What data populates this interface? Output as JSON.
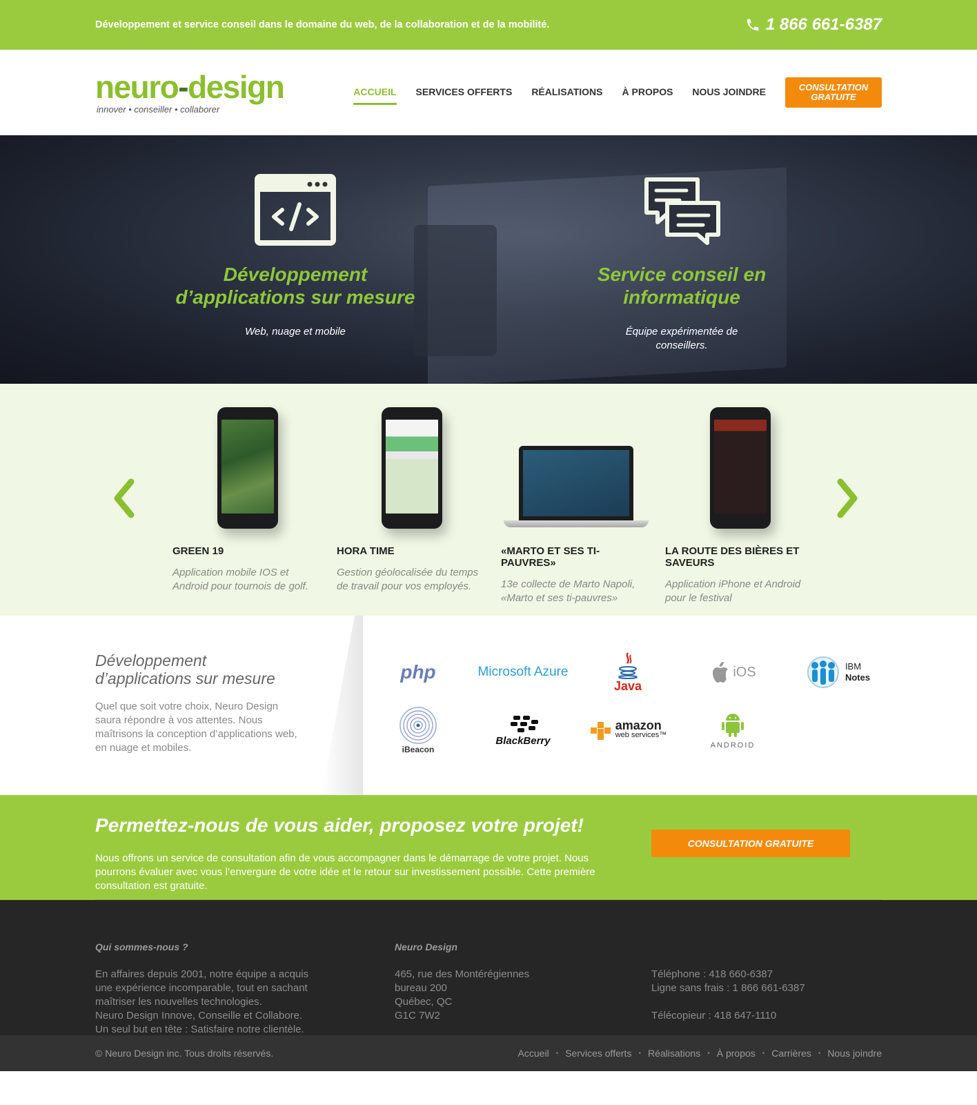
{
  "topbar": {
    "tagline": "Développement et service conseil dans le domaine du web, de la collaboration et de la mobilité.",
    "phone": "1 866 661-6387",
    "phone_icon": "phone-icon",
    "bg_color": "#9acb3e"
  },
  "header": {
    "logo_part1": "neuro",
    "logo_part2": "design",
    "logo_sub": "innover • conseiller • collaborer",
    "nav": [
      {
        "label": "ACCUEIL",
        "active": true
      },
      {
        "label": "SERVICES OFFERTS"
      },
      {
        "label": "RÉALISATIONS"
      },
      {
        "label": "À PROPOS"
      },
      {
        "label": "NOUS JOINDRE"
      }
    ],
    "cta": "CONSULTATION GRATUITE",
    "accent_color": "#8bbf2f",
    "cta_color": "#f48a0c"
  },
  "hero": {
    "items": [
      {
        "icon": "code-window-icon",
        "title_line1": "Développement",
        "title_line2": "d’applications sur mesure",
        "subtitle": "Web, nuage et mobile"
      },
      {
        "icon": "chat-bubbles-icon",
        "title_line1": "Service conseil en",
        "title_line2": "informatique",
        "subtitle": "Équipe expérimentée de conseillers."
      }
    ]
  },
  "projects": {
    "items": [
      {
        "title": "GREEN 19",
        "desc": "Application mobile IOS et Android pour tournois de golf."
      },
      {
        "title": "HORA TIME",
        "desc": "Gestion géolocalisée du temps de travail pour vos employés."
      },
      {
        "title": "«MARTO ET SES TI-PAUVRES»",
        "desc": "13e collecte de Marto Napoli, «Marto et ses ti-pauvres»"
      },
      {
        "title": "LA ROUTE DES BIÈRES ET SAVEURS",
        "desc": "Application iPhone et Android pour le festival"
      }
    ],
    "prev_icon": "chevron-left-icon",
    "next_icon": "chevron-right-icon"
  },
  "tech": {
    "heading": "Développement d’applications sur mesure",
    "text": "Quel que soit votre choix, Neuro Design saura répondre à vos attentes. Nous maîtrisons la conception d’applications web, en nuage et mobiles.",
    "logos": {
      "php": "php",
      "azure": "Microsoft Azure",
      "java": "Java",
      "ios": "iOS",
      "ibm_line1": "IBM",
      "ibm_line2": "Notes",
      "ibeacon": "iBeacon",
      "blackberry": "BlackBerry",
      "amazon": "amazon",
      "amazon_sub": "web services™",
      "android": "ANDROID"
    }
  },
  "band": {
    "heading": "Permettez-nous de vous aider, proposez votre projet!",
    "text": "Nous offrons un service de consultation afin de vous accompagner dans le démarrage de votre projet. Nous pourrons évaluer avec vous l’envergure de votre idée et le retour sur investissement possible. Cette première consultation est gratuite.",
    "button": "CONSULTATION GRATUITE"
  },
  "footer": {
    "about_title": "Qui sommes-nous ?",
    "about_lines": [
      "En affaires depuis 2001, notre équipe a acquis",
      "une expérience incomparable, tout en sachant",
      "maîtriser les nouvelles technologies.",
      "Neuro Design Innove, Conseille et Collabore.",
      "Un seul but en tête : Satisfaire notre clientèle."
    ],
    "company_title": "Neuro Design",
    "address_lines": [
      "465, rue des Montérégiennes",
      "bureau 200",
      "Québec, QC",
      "G1C 7W2"
    ],
    "phone": "Téléphone : 418 660-6387",
    "tollfree": "Ligne sans frais : 1 866 661-6387",
    "fax": "Télécopieur : 418 647-1110",
    "copyright": "© Neuro Design inc. Tous droits réservés.",
    "links": [
      "Accueil",
      "Services offerts",
      "Réalisations",
      "À propos",
      "Carrières",
      "Nous joindre"
    ]
  }
}
